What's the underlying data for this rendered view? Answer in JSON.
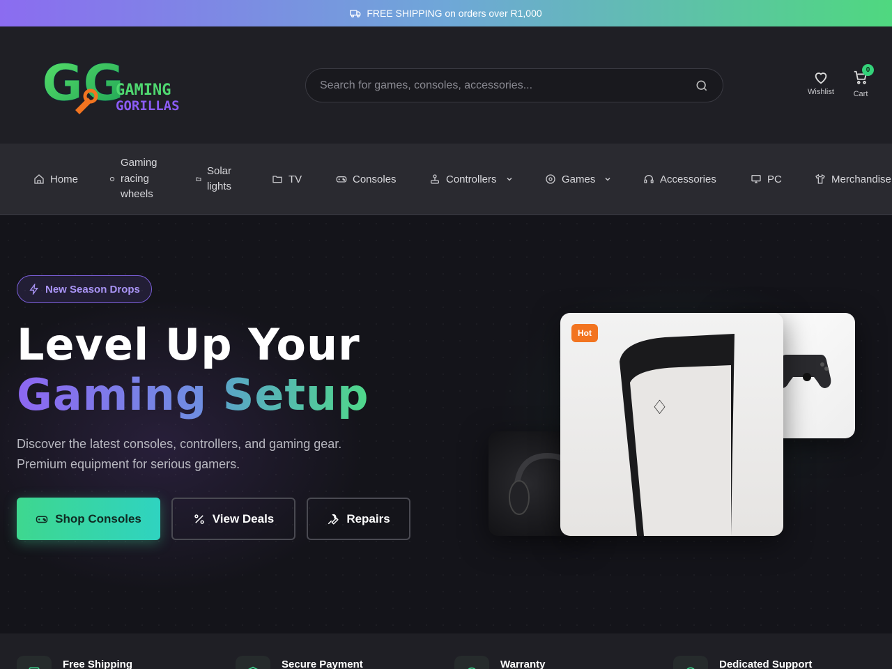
{
  "announcement": {
    "text": "FREE SHIPPING on orders over R1,000",
    "icon": "truck-icon"
  },
  "header": {
    "logo": {
      "letters": "GG",
      "line1": "GAMING",
      "line2": "GORILLAS"
    },
    "search": {
      "placeholder": "Search for games, consoles, accessories...",
      "value": ""
    },
    "wishlist_label": "Wishlist",
    "cart_label": "Cart",
    "cart_count": "0"
  },
  "nav": {
    "items": [
      {
        "label": "Home",
        "icon": "home-icon"
      },
      {
        "label": "Gaming racing wheels",
        "icon": "circle-icon"
      },
      {
        "label": "Solar lights",
        "icon": "folder-icon"
      },
      {
        "label": "TV",
        "icon": "folder-icon"
      },
      {
        "label": "Consoles",
        "icon": "gamepad-icon"
      },
      {
        "label": "Controllers",
        "icon": "joystick-icon",
        "dropdown": true
      },
      {
        "label": "Games",
        "icon": "disc-icon",
        "dropdown": true
      },
      {
        "label": "Accessories",
        "icon": "headphones-icon"
      },
      {
        "label": "PC",
        "icon": "monitor-icon"
      },
      {
        "label": "Merchandise",
        "icon": "shirt-icon"
      }
    ]
  },
  "hero": {
    "badge": "New Season Drops",
    "title_line1": "Level Up Your",
    "title_word1": "Gaming",
    "title_word2": "Setup",
    "description": "Discover the latest consoles, controllers, and gaming gear. Premium equipment for serious gamers.",
    "buttons": {
      "primary": "Shop Consoles",
      "deals": "View Deals",
      "repairs": "Repairs"
    },
    "product_badge": "Hot"
  },
  "features": [
    {
      "title": "Free Shipping",
      "icon": "package-icon"
    },
    {
      "title": "Secure Payment",
      "icon": "shield-icon"
    },
    {
      "title": "Warranty",
      "icon": "refresh-icon"
    },
    {
      "title": "Dedicated Support",
      "icon": "headset-icon"
    }
  ],
  "colors": {
    "accent_green": "#3ed78f",
    "accent_purple": "#8d67f2",
    "hot_badge": "#f27420",
    "background": "#14141a"
  }
}
